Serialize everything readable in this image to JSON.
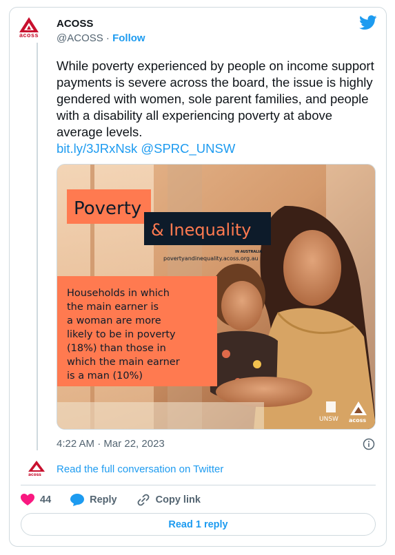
{
  "account": {
    "name": "ACOSS",
    "handle": "@ACOSS",
    "separator": "·",
    "follow_label": "Follow",
    "logo_text": "acoss"
  },
  "tweet": {
    "text": "While poverty experienced by people on income support payments is severe across the board, the issue is highly gendered with women, sole parent families, and people with a disability all experiencing poverty at above average levels.",
    "link_1": "bit.ly/3JRxNsk",
    "link_2": "@SPRC_UNSW",
    "timestamp": "4:22 AM · Mar 22, 2023"
  },
  "media": {
    "title_line_1": "Poverty",
    "title_line_2": "& Inequality",
    "in_australia": "IN AUSTRALIA",
    "url": "povertyandinequality.acoss.org.au",
    "statement": [
      "Households in which",
      "the main earner is",
      "a woman are more",
      "likely to be in poverty",
      "(18%) than those in",
      "which the main earner",
      "is a man (10%)"
    ],
    "partner_1": "UNSW",
    "partner_2": "acoss",
    "colors": {
      "orange": "#ff7a50",
      "navy": "#0d1b2a"
    }
  },
  "conversation": {
    "label": "Read the full conversation on Twitter"
  },
  "actions": {
    "likes": "44",
    "reply_label": "Reply",
    "copy_label": "Copy link",
    "read_reply_label": "Read 1 reply"
  },
  "colors": {
    "accent": "#1d9bf0",
    "brand": "#c8102e",
    "like": "#f91880"
  }
}
